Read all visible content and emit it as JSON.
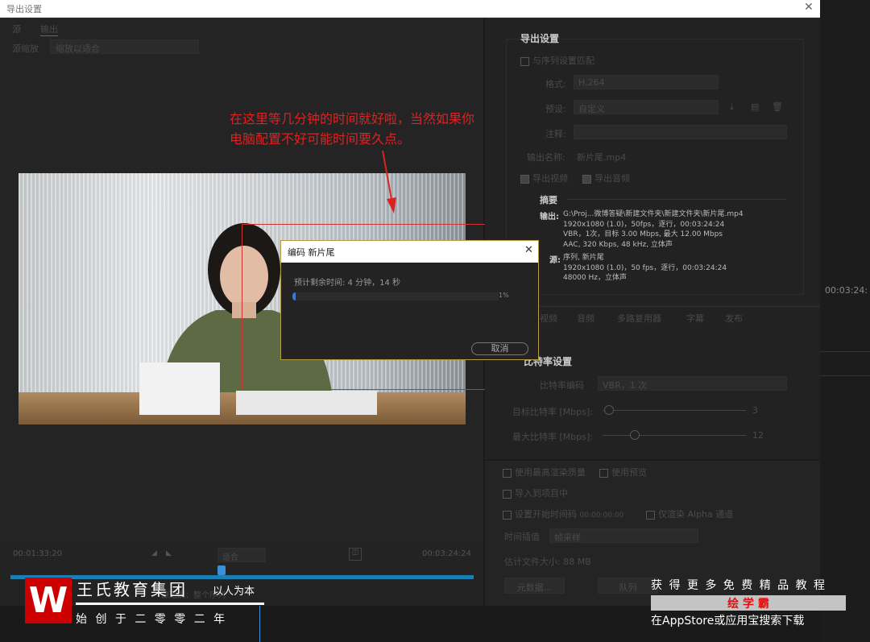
{
  "window": {
    "title": "导出设置",
    "close": "✕"
  },
  "left": {
    "tabs": [
      "源",
      "输出"
    ],
    "source_scale_label": "源缩放",
    "source_scale_value": "缩放以适合"
  },
  "annotation": {
    "line1": "在这里等几分钟的时间就好啦，当然如果你",
    "line2": "电脑配置不好可能时间要久点。"
  },
  "encode_dialog": {
    "title": "编码 新片尾",
    "close": "✕",
    "remaining": "预计剩余时间: 4 分钟，14 秒",
    "progress_percent": 1,
    "progress_label": "1%",
    "cancel": "取消",
    "accent": "#3b78d8"
  },
  "timeline": {
    "in_time": "00:01:33:20",
    "out_time": "00:03:24:24",
    "fit": "适合",
    "source_range": "源范围：整个序列"
  },
  "export": {
    "heading": "导出设置",
    "match_seq": "与序列设置匹配",
    "format_label": "格式:",
    "format_value": "H.264",
    "preset_label": "预设:",
    "preset_value": "自定义",
    "comment_label": "注释:",
    "output_name_label": "输出名称:",
    "output_name_value": "新片尾.mp4",
    "export_video": "导出视频",
    "export_audio": "导出音频",
    "summary": {
      "heading": "摘要",
      "output_label": "输出:",
      "output_lines": [
        "G:\\Proj...微博答疑\\新建文件夹\\新建文件夹\\新片尾.mp4",
        "1920x1080 (1.0)，50fps，逐行，00:03:24:24",
        "VBR，1次，目标 3.00 Mbps, 最大 12.00 Mbps",
        "AAC, 320 Kbps, 48  kHz, 立体声"
      ],
      "source_label": "源:",
      "source_lines": [
        "序列, 新片尾",
        "1920x1080 (1.0)，50 fps，逐行，00:03:24:24",
        "48000 Hz，立体声"
      ]
    }
  },
  "tabs": [
    "视频",
    "音频",
    "多路复用器",
    "字幕",
    "发布"
  ],
  "bitrate": {
    "heading": "比特率设置",
    "encoding_label": "比特率编码",
    "encoding_value": "VBR，1 次",
    "target_label": "目标比特率 [Mbps]:",
    "target_value": "3",
    "max_label": "最大比特率 [Mbps]:",
    "max_value": "12"
  },
  "bottom": {
    "max_quality": "使用最高渲染质量",
    "use_preview": "使用预览",
    "import_project": "导入到项目中",
    "set_start_tc": "设置开始时间码",
    "start_tc": "00:00:00:00",
    "alpha_only": "仅渲染 Alpha 通道",
    "interp_label": "时间插值",
    "interp_value": "帧采样",
    "file_size_label": "估计文件大小:",
    "file_size_value": "88 MB",
    "metadata_btn": "元数据...",
    "queue_btn": "队列"
  },
  "strip": {
    "time": "00:03:24:"
  },
  "branding": {
    "logo": "W",
    "company": "王氏教育集团",
    "slogan": "以人为本",
    "founded": "始 创 于 二 零 零 二 年"
  },
  "promo": {
    "line1": "获 得 更 多 免 费 精 品 教 程",
    "app": "绘 学 霸",
    "line3": "在AppStore或应用宝搜索下载"
  }
}
